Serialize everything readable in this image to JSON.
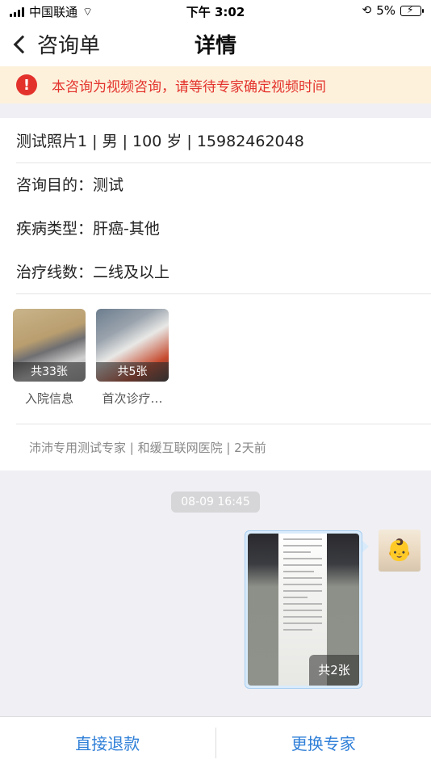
{
  "status_bar": {
    "carrier": "中国联通",
    "time": "下午 3:02",
    "battery": "5%"
  },
  "nav": {
    "back_label": "咨询单",
    "title": "详情"
  },
  "notice": {
    "text": "本咨询为视频咨询，请等待专家确定视频时间"
  },
  "patient": {
    "summary": "测试照片1 | 男 | 100 岁 | 15982462048",
    "purpose_label": "咨询目的：",
    "purpose_value": "测试",
    "disease_label": "疾病类型：",
    "disease_value": "肝癌-其他",
    "therapy_label": "治疗线数：",
    "therapy_value": "二线及以上"
  },
  "attachments": [
    {
      "count": "共33张",
      "label": "入院信息"
    },
    {
      "count": "共5张",
      "label": "首次诊疗…"
    }
  ],
  "expert_info": "沛沛专用测试专家 | 和缓互联网医院 | 2天前",
  "chat": {
    "timestamp": "08-09 16:45",
    "image_count": "共2张"
  },
  "actions": {
    "refund": "直接退款",
    "change_expert": "更换专家"
  }
}
